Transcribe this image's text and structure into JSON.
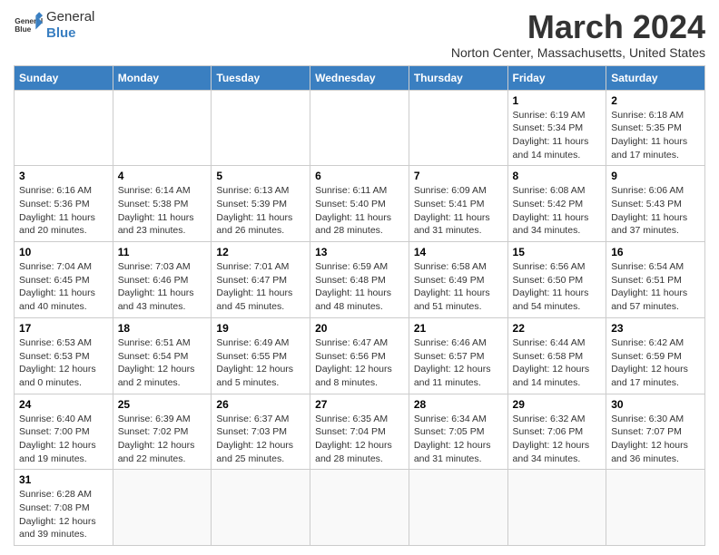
{
  "header": {
    "logo_text_normal": "General",
    "logo_text_bold": "Blue",
    "title": "March 2024",
    "subtitle": "Norton Center, Massachusetts, United States"
  },
  "days_of_week": [
    "Sunday",
    "Monday",
    "Tuesday",
    "Wednesday",
    "Thursday",
    "Friday",
    "Saturday"
  ],
  "weeks": [
    [
      {
        "day": "",
        "info": ""
      },
      {
        "day": "",
        "info": ""
      },
      {
        "day": "",
        "info": ""
      },
      {
        "day": "",
        "info": ""
      },
      {
        "day": "",
        "info": ""
      },
      {
        "day": "1",
        "info": "Sunrise: 6:19 AM\nSunset: 5:34 PM\nDaylight: 11 hours and 14 minutes."
      },
      {
        "day": "2",
        "info": "Sunrise: 6:18 AM\nSunset: 5:35 PM\nDaylight: 11 hours and 17 minutes."
      }
    ],
    [
      {
        "day": "3",
        "info": "Sunrise: 6:16 AM\nSunset: 5:36 PM\nDaylight: 11 hours and 20 minutes."
      },
      {
        "day": "4",
        "info": "Sunrise: 6:14 AM\nSunset: 5:38 PM\nDaylight: 11 hours and 23 minutes."
      },
      {
        "day": "5",
        "info": "Sunrise: 6:13 AM\nSunset: 5:39 PM\nDaylight: 11 hours and 26 minutes."
      },
      {
        "day": "6",
        "info": "Sunrise: 6:11 AM\nSunset: 5:40 PM\nDaylight: 11 hours and 28 minutes."
      },
      {
        "day": "7",
        "info": "Sunrise: 6:09 AM\nSunset: 5:41 PM\nDaylight: 11 hours and 31 minutes."
      },
      {
        "day": "8",
        "info": "Sunrise: 6:08 AM\nSunset: 5:42 PM\nDaylight: 11 hours and 34 minutes."
      },
      {
        "day": "9",
        "info": "Sunrise: 6:06 AM\nSunset: 5:43 PM\nDaylight: 11 hours and 37 minutes."
      }
    ],
    [
      {
        "day": "10",
        "info": "Sunrise: 7:04 AM\nSunset: 6:45 PM\nDaylight: 11 hours and 40 minutes."
      },
      {
        "day": "11",
        "info": "Sunrise: 7:03 AM\nSunset: 6:46 PM\nDaylight: 11 hours and 43 minutes."
      },
      {
        "day": "12",
        "info": "Sunrise: 7:01 AM\nSunset: 6:47 PM\nDaylight: 11 hours and 45 minutes."
      },
      {
        "day": "13",
        "info": "Sunrise: 6:59 AM\nSunset: 6:48 PM\nDaylight: 11 hours and 48 minutes."
      },
      {
        "day": "14",
        "info": "Sunrise: 6:58 AM\nSunset: 6:49 PM\nDaylight: 11 hours and 51 minutes."
      },
      {
        "day": "15",
        "info": "Sunrise: 6:56 AM\nSunset: 6:50 PM\nDaylight: 11 hours and 54 minutes."
      },
      {
        "day": "16",
        "info": "Sunrise: 6:54 AM\nSunset: 6:51 PM\nDaylight: 11 hours and 57 minutes."
      }
    ],
    [
      {
        "day": "17",
        "info": "Sunrise: 6:53 AM\nSunset: 6:53 PM\nDaylight: 12 hours and 0 minutes."
      },
      {
        "day": "18",
        "info": "Sunrise: 6:51 AM\nSunset: 6:54 PM\nDaylight: 12 hours and 2 minutes."
      },
      {
        "day": "19",
        "info": "Sunrise: 6:49 AM\nSunset: 6:55 PM\nDaylight: 12 hours and 5 minutes."
      },
      {
        "day": "20",
        "info": "Sunrise: 6:47 AM\nSunset: 6:56 PM\nDaylight: 12 hours and 8 minutes."
      },
      {
        "day": "21",
        "info": "Sunrise: 6:46 AM\nSunset: 6:57 PM\nDaylight: 12 hours and 11 minutes."
      },
      {
        "day": "22",
        "info": "Sunrise: 6:44 AM\nSunset: 6:58 PM\nDaylight: 12 hours and 14 minutes."
      },
      {
        "day": "23",
        "info": "Sunrise: 6:42 AM\nSunset: 6:59 PM\nDaylight: 12 hours and 17 minutes."
      }
    ],
    [
      {
        "day": "24",
        "info": "Sunrise: 6:40 AM\nSunset: 7:00 PM\nDaylight: 12 hours and 19 minutes."
      },
      {
        "day": "25",
        "info": "Sunrise: 6:39 AM\nSunset: 7:02 PM\nDaylight: 12 hours and 22 minutes."
      },
      {
        "day": "26",
        "info": "Sunrise: 6:37 AM\nSunset: 7:03 PM\nDaylight: 12 hours and 25 minutes."
      },
      {
        "day": "27",
        "info": "Sunrise: 6:35 AM\nSunset: 7:04 PM\nDaylight: 12 hours and 28 minutes."
      },
      {
        "day": "28",
        "info": "Sunrise: 6:34 AM\nSunset: 7:05 PM\nDaylight: 12 hours and 31 minutes."
      },
      {
        "day": "29",
        "info": "Sunrise: 6:32 AM\nSunset: 7:06 PM\nDaylight: 12 hours and 34 minutes."
      },
      {
        "day": "30",
        "info": "Sunrise: 6:30 AM\nSunset: 7:07 PM\nDaylight: 12 hours and 36 minutes."
      }
    ],
    [
      {
        "day": "31",
        "info": "Sunrise: 6:28 AM\nSunset: 7:08 PM\nDaylight: 12 hours and 39 minutes."
      },
      {
        "day": "",
        "info": ""
      },
      {
        "day": "",
        "info": ""
      },
      {
        "day": "",
        "info": ""
      },
      {
        "day": "",
        "info": ""
      },
      {
        "day": "",
        "info": ""
      },
      {
        "day": "",
        "info": ""
      }
    ]
  ]
}
